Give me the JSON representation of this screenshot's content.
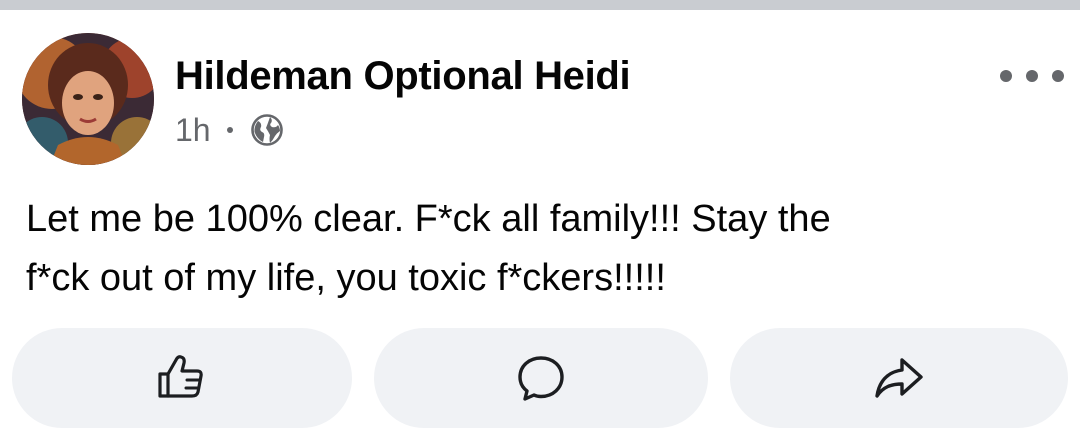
{
  "post": {
    "author": "Hildeman Optional Heidi",
    "timestamp": "1h",
    "separator": "•",
    "audience_icon": "globe-icon",
    "more_icon": "more-horizontal-icon",
    "text_lines": [
      "Let me be 100% clear. F*ck all family!!! Stay the",
      "f*ck out of my life, you toxic f*ckers!!!!!"
    ]
  },
  "actions": {
    "like_icon": "thumbs-up-icon",
    "comment_icon": "comment-bubble-icon",
    "share_icon": "share-arrow-icon"
  },
  "colors": {
    "divider": "#c9ccd1",
    "action_background": "#f0f2f5",
    "primary_text": "#050505",
    "secondary_text": "#65676b"
  }
}
